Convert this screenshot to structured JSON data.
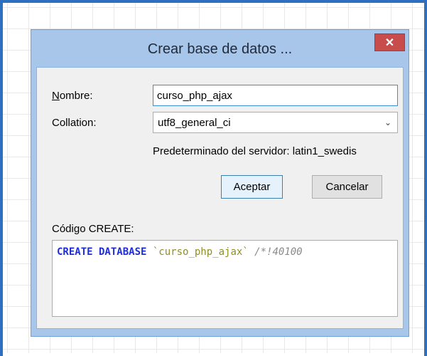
{
  "dialog": {
    "title": "Crear base de datos ...",
    "close_symbol": "✕"
  },
  "form": {
    "nombre_label_mnemonic": "N",
    "nombre_label_rest": "ombre:",
    "nombre_value": "curso_php_ajax",
    "collation_label": "Collation:",
    "collation_value": "utf8_general_ci",
    "server_default": "Predeterminado del servidor: latin1_swedis"
  },
  "buttons": {
    "accept_label": "Aceptar",
    "cancel_label": "Cancelar"
  },
  "create_code": {
    "label": "Código CREATE:",
    "keyword": "CREATE DATABASE",
    "db_name": "`curso_php_ajax`",
    "comment": "/*!40100 "
  },
  "icons": {
    "close": "close-icon",
    "dropdown": "chevron-down-icon"
  },
  "colors": {
    "frame_blue": "#2f6fbf",
    "dialog_frame": "#a8c6ea",
    "close_red": "#c94c4c",
    "sql_keyword": "#1f2fd8",
    "sql_string": "#8f8f27",
    "sql_comment": "#8a8a8a"
  }
}
